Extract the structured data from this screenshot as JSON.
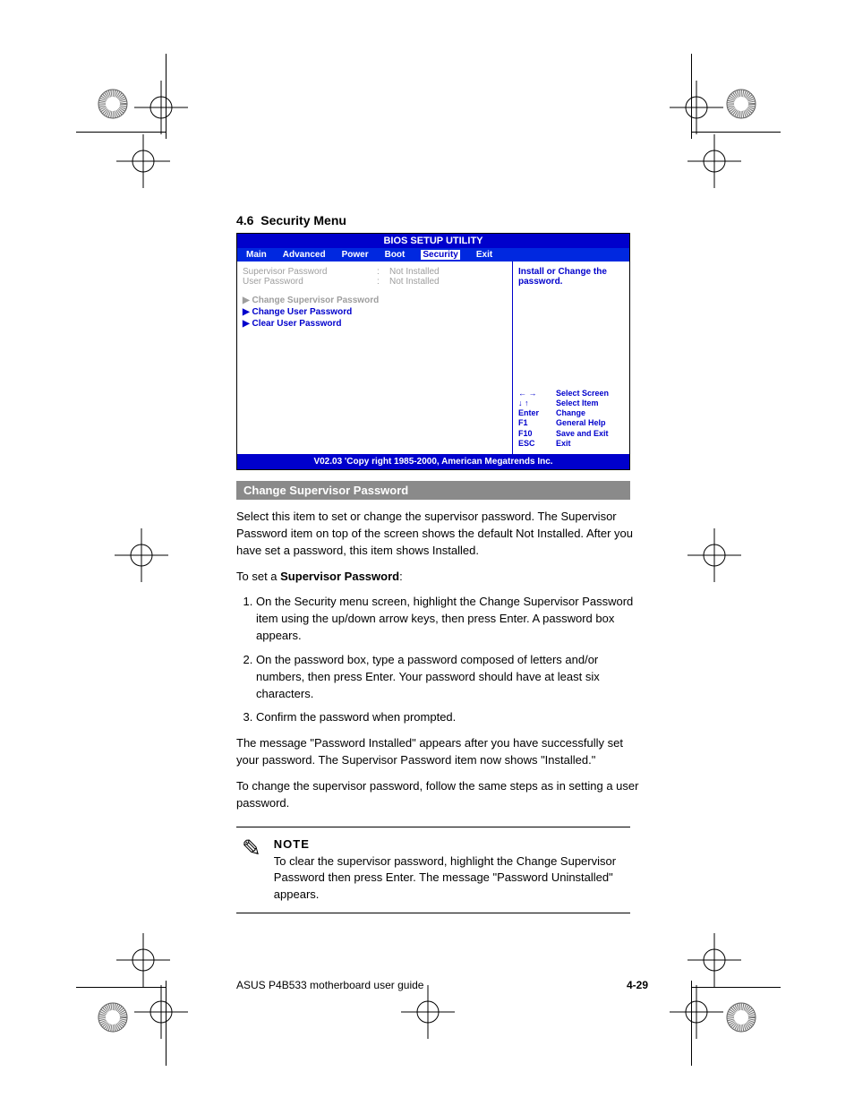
{
  "doc": {
    "section_number": "4.6",
    "section_title": "Security Menu",
    "footer_left": "ASUS P4B533 motherboard user guide",
    "footer_right": "4-29"
  },
  "bios": {
    "title": "BIOS SETUP UTILITY",
    "tabs": [
      "Main",
      "Advanced",
      "Power",
      "Boot",
      "Security",
      "Exit"
    ],
    "active_tab": "Security",
    "status": [
      {
        "label": "Supervisor Password",
        "sep": ":",
        "value": "Not Installed"
      },
      {
        "label": "User Password",
        "sep": ":",
        "value": "Not Installed"
      }
    ],
    "menu_items": [
      {
        "label": "Change Supervisor Password",
        "dim": true
      },
      {
        "label": "Change User Password",
        "dim": false
      },
      {
        "label": "Clear User Password",
        "dim": false
      }
    ],
    "help_text": "Install or Change the password.",
    "nav": [
      {
        "key": "← →",
        "desc": "Select Screen"
      },
      {
        "key": "↓  ↑",
        "desc": "Select Item"
      },
      {
        "key": "Enter",
        "desc": "Change"
      },
      {
        "key": "F1",
        "desc": "General Help"
      },
      {
        "key": "F10",
        "desc": "Save and Exit"
      },
      {
        "key": "ESC",
        "desc": "Exit"
      }
    ],
    "footer": "V02.03 'Copy  right 1985-2000, American Megatrends Inc."
  },
  "body": {
    "change_supervisor_heading": "Change Supervisor Password",
    "p1": "Select this item to set or change the supervisor password. The Supervisor Password item on top of the screen shows the default Not Installed. After you have set a password, this item shows Installed.",
    "p2_prefix": "To set a ",
    "p2_strong": "Supervisor Password",
    "p2_suffix": ":",
    "steps": [
      "On the Security menu screen, highlight the Change Supervisor Password item using the up/down arrow keys, then press Enter. A password box appears.",
      "On the password box, type a password composed of letters and/or numbers, then press Enter. Your password should have at least six characters.",
      "Confirm the password when prompted."
    ],
    "after_steps": "The message \"Password Installed\" appears after you have successfully set your password. The Supervisor Password item now shows \"Installed.\"",
    "to_change_para": "To change the supervisor password, follow the same steps as in setting a user password.",
    "note_label": "NOTE",
    "note_text": "To clear the supervisor password, highlight the Change Supervisor Password then press Enter. The message \"Password Uninstalled\" appears."
  }
}
